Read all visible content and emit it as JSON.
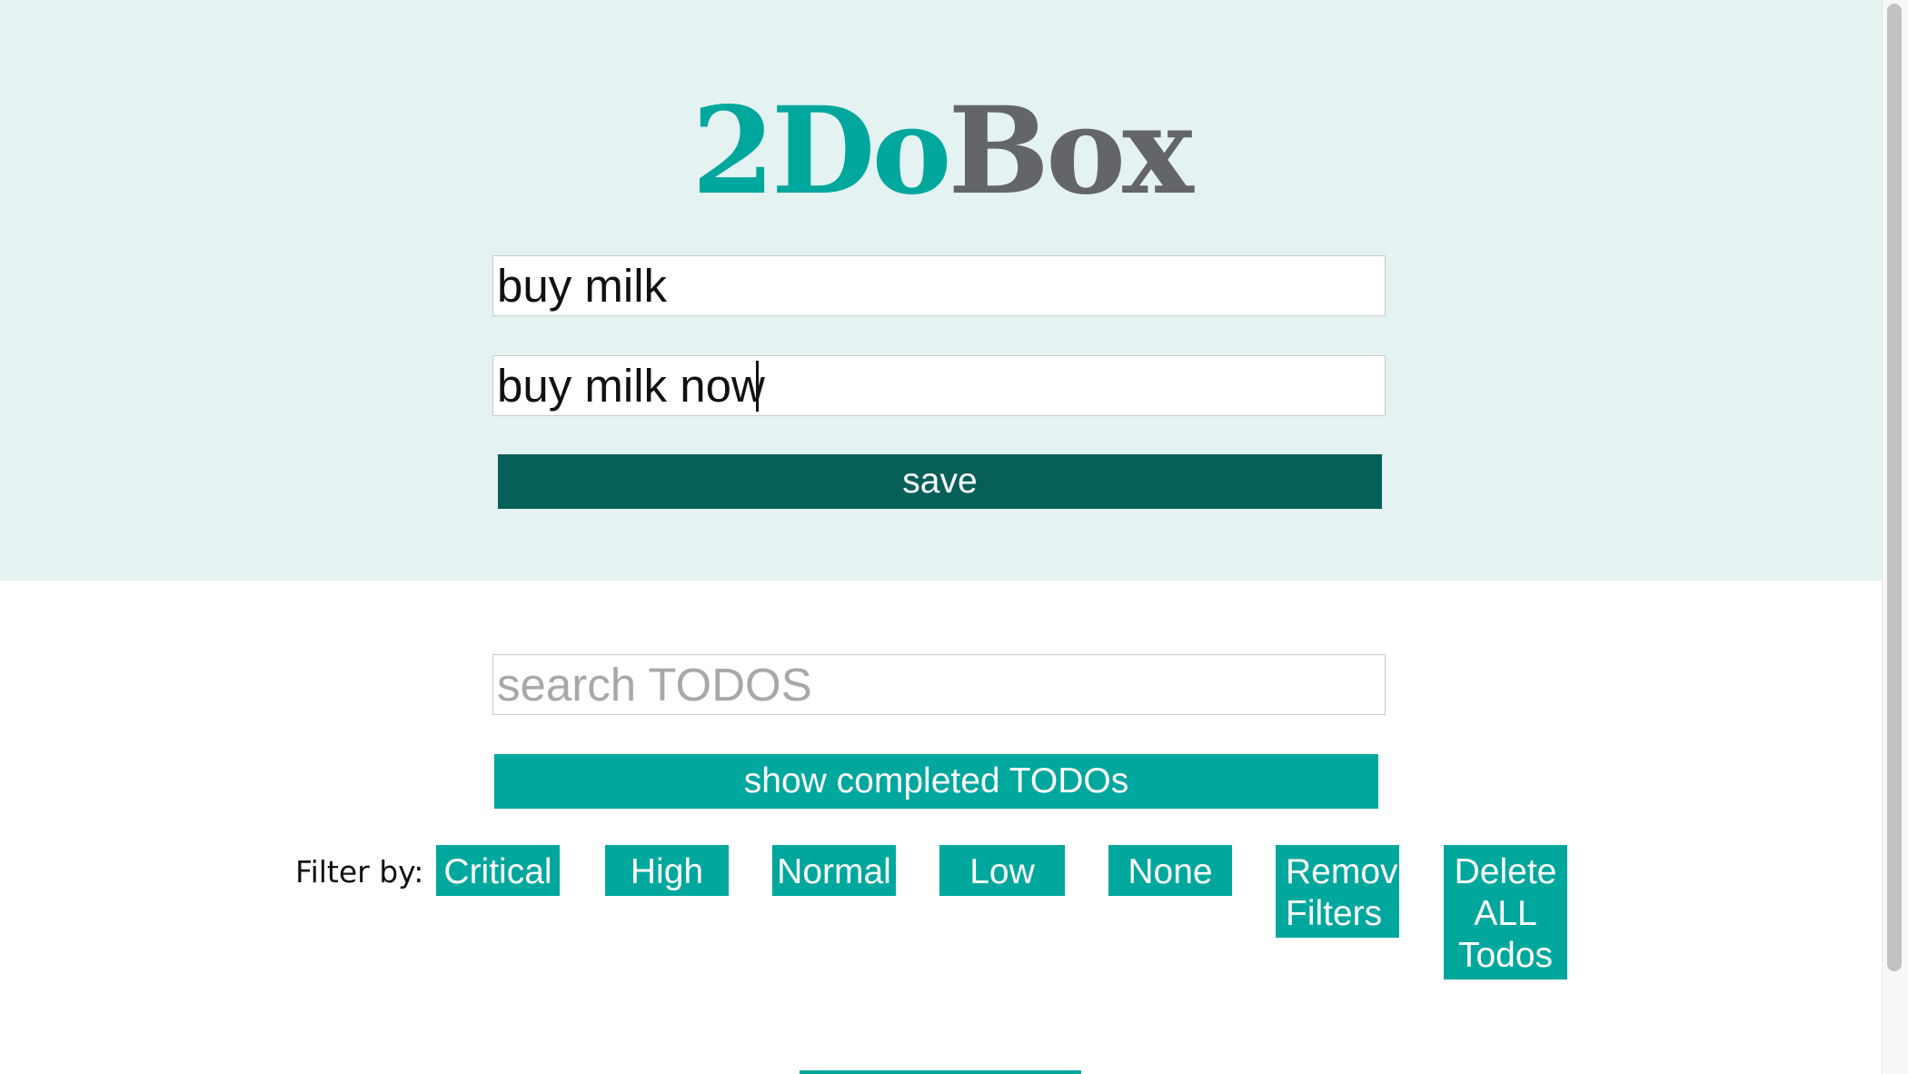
{
  "app": {
    "title_part1": "2Do",
    "title_part2": "Box"
  },
  "colors": {
    "accent": "#00a79d",
    "save_button": "#065f58",
    "header_background": "#e4f2f2",
    "title_gray": "#636569"
  },
  "form": {
    "title_value": "buy milk",
    "body_value": "buy milk now",
    "save_label": "save"
  },
  "search": {
    "placeholder": "search TODOS",
    "value": ""
  },
  "show_completed_label": "show completed TODOs",
  "filters": {
    "label": "Filter by:",
    "critical": "Critical",
    "high": "High",
    "normal": "Normal",
    "low": "Low",
    "none": "None",
    "remove_line1": "Remove",
    "remove_line2": "Filters",
    "delete_line1": "Delete",
    "delete_line2": "ALL",
    "delete_line3": "Todos"
  }
}
